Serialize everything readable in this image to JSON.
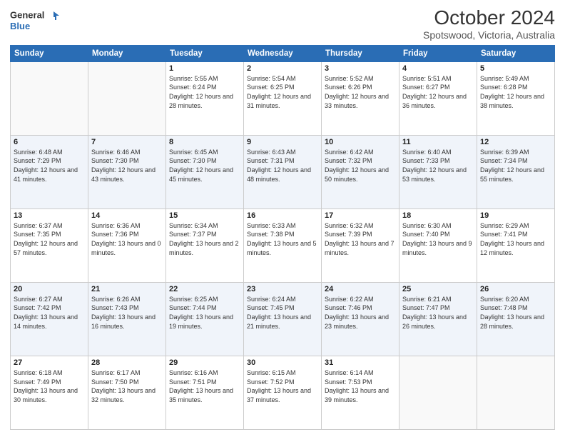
{
  "header": {
    "logo_line1": "General",
    "logo_line2": "Blue",
    "month": "October 2024",
    "location": "Spotswood, Victoria, Australia"
  },
  "weekdays": [
    "Sunday",
    "Monday",
    "Tuesday",
    "Wednesday",
    "Thursday",
    "Friday",
    "Saturday"
  ],
  "weeks": [
    [
      {
        "day": "",
        "info": ""
      },
      {
        "day": "",
        "info": ""
      },
      {
        "day": "1",
        "info": "Sunrise: 5:55 AM\nSunset: 6:24 PM\nDaylight: 12 hours and 28 minutes."
      },
      {
        "day": "2",
        "info": "Sunrise: 5:54 AM\nSunset: 6:25 PM\nDaylight: 12 hours and 31 minutes."
      },
      {
        "day": "3",
        "info": "Sunrise: 5:52 AM\nSunset: 6:26 PM\nDaylight: 12 hours and 33 minutes."
      },
      {
        "day": "4",
        "info": "Sunrise: 5:51 AM\nSunset: 6:27 PM\nDaylight: 12 hours and 36 minutes."
      },
      {
        "day": "5",
        "info": "Sunrise: 5:49 AM\nSunset: 6:28 PM\nDaylight: 12 hours and 38 minutes."
      }
    ],
    [
      {
        "day": "6",
        "info": "Sunrise: 6:48 AM\nSunset: 7:29 PM\nDaylight: 12 hours and 41 minutes."
      },
      {
        "day": "7",
        "info": "Sunrise: 6:46 AM\nSunset: 7:30 PM\nDaylight: 12 hours and 43 minutes."
      },
      {
        "day": "8",
        "info": "Sunrise: 6:45 AM\nSunset: 7:30 PM\nDaylight: 12 hours and 45 minutes."
      },
      {
        "day": "9",
        "info": "Sunrise: 6:43 AM\nSunset: 7:31 PM\nDaylight: 12 hours and 48 minutes."
      },
      {
        "day": "10",
        "info": "Sunrise: 6:42 AM\nSunset: 7:32 PM\nDaylight: 12 hours and 50 minutes."
      },
      {
        "day": "11",
        "info": "Sunrise: 6:40 AM\nSunset: 7:33 PM\nDaylight: 12 hours and 53 minutes."
      },
      {
        "day": "12",
        "info": "Sunrise: 6:39 AM\nSunset: 7:34 PM\nDaylight: 12 hours and 55 minutes."
      }
    ],
    [
      {
        "day": "13",
        "info": "Sunrise: 6:37 AM\nSunset: 7:35 PM\nDaylight: 12 hours and 57 minutes."
      },
      {
        "day": "14",
        "info": "Sunrise: 6:36 AM\nSunset: 7:36 PM\nDaylight: 13 hours and 0 minutes."
      },
      {
        "day": "15",
        "info": "Sunrise: 6:34 AM\nSunset: 7:37 PM\nDaylight: 13 hours and 2 minutes."
      },
      {
        "day": "16",
        "info": "Sunrise: 6:33 AM\nSunset: 7:38 PM\nDaylight: 13 hours and 5 minutes."
      },
      {
        "day": "17",
        "info": "Sunrise: 6:32 AM\nSunset: 7:39 PM\nDaylight: 13 hours and 7 minutes."
      },
      {
        "day": "18",
        "info": "Sunrise: 6:30 AM\nSunset: 7:40 PM\nDaylight: 13 hours and 9 minutes."
      },
      {
        "day": "19",
        "info": "Sunrise: 6:29 AM\nSunset: 7:41 PM\nDaylight: 13 hours and 12 minutes."
      }
    ],
    [
      {
        "day": "20",
        "info": "Sunrise: 6:27 AM\nSunset: 7:42 PM\nDaylight: 13 hours and 14 minutes."
      },
      {
        "day": "21",
        "info": "Sunrise: 6:26 AM\nSunset: 7:43 PM\nDaylight: 13 hours and 16 minutes."
      },
      {
        "day": "22",
        "info": "Sunrise: 6:25 AM\nSunset: 7:44 PM\nDaylight: 13 hours and 19 minutes."
      },
      {
        "day": "23",
        "info": "Sunrise: 6:24 AM\nSunset: 7:45 PM\nDaylight: 13 hours and 21 minutes."
      },
      {
        "day": "24",
        "info": "Sunrise: 6:22 AM\nSunset: 7:46 PM\nDaylight: 13 hours and 23 minutes."
      },
      {
        "day": "25",
        "info": "Sunrise: 6:21 AM\nSunset: 7:47 PM\nDaylight: 13 hours and 26 minutes."
      },
      {
        "day": "26",
        "info": "Sunrise: 6:20 AM\nSunset: 7:48 PM\nDaylight: 13 hours and 28 minutes."
      }
    ],
    [
      {
        "day": "27",
        "info": "Sunrise: 6:18 AM\nSunset: 7:49 PM\nDaylight: 13 hours and 30 minutes."
      },
      {
        "day": "28",
        "info": "Sunrise: 6:17 AM\nSunset: 7:50 PM\nDaylight: 13 hours and 32 minutes."
      },
      {
        "day": "29",
        "info": "Sunrise: 6:16 AM\nSunset: 7:51 PM\nDaylight: 13 hours and 35 minutes."
      },
      {
        "day": "30",
        "info": "Sunrise: 6:15 AM\nSunset: 7:52 PM\nDaylight: 13 hours and 37 minutes."
      },
      {
        "day": "31",
        "info": "Sunrise: 6:14 AM\nSunset: 7:53 PM\nDaylight: 13 hours and 39 minutes."
      },
      {
        "day": "",
        "info": ""
      },
      {
        "day": "",
        "info": ""
      }
    ]
  ]
}
